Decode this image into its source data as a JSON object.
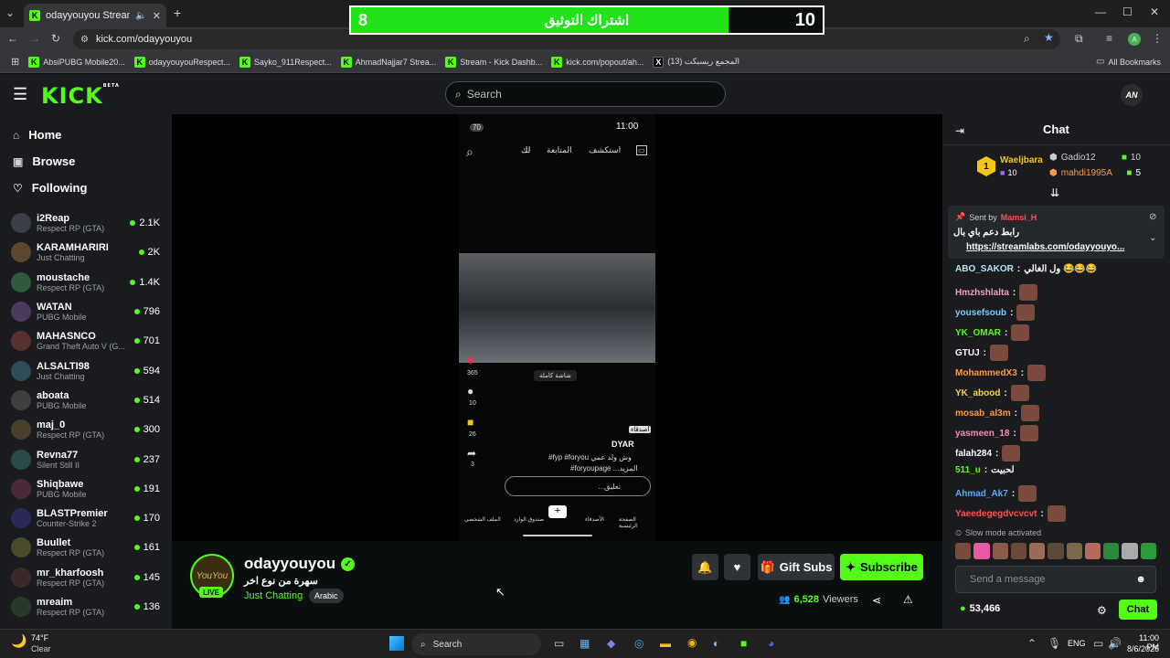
{
  "browser": {
    "tab_title": "odayyouyou Stream - Watc",
    "url": "kick.com/odayyouyou",
    "bookmarks": [
      {
        "label": "AbsiPUBG Mobile20..."
      },
      {
        "label": "odayyouyouRespect..."
      },
      {
        "label": "Sayko_911Respect..."
      },
      {
        "label": "AhmadNajjar7 Strea..."
      },
      {
        "label": "Stream - Kick Dashb..."
      },
      {
        "label": "kick.com/popout/ah..."
      },
      {
        "label": "(13) المجمع ريسبكت"
      }
    ],
    "all_bookmarks": "All Bookmarks"
  },
  "overlay": {
    "left_number": "8",
    "title": "اشتراك التوثيق",
    "right_number": "10",
    "progress_fraction": 0.8
  },
  "header": {
    "logo": "KICK",
    "beta": "BETA",
    "search_placeholder": "Search",
    "user_initials": "AN"
  },
  "sidebar": {
    "nav": [
      {
        "label": "Home",
        "icon": "home-icon"
      },
      {
        "label": "Browse",
        "icon": "browse-icon"
      },
      {
        "label": "Following",
        "icon": "heart-icon"
      }
    ],
    "channels": [
      {
        "name": "i2Reap",
        "category": "Respect RP (GTA)",
        "viewers": "2.1K"
      },
      {
        "name": "KARAMHARIRI",
        "category": "Just Chatting",
        "viewers": "2K"
      },
      {
        "name": "moustache",
        "category": "Respect RP (GTA)",
        "viewers": "1.4K"
      },
      {
        "name": "WATAN",
        "category": "PUBG Mobile",
        "viewers": "796"
      },
      {
        "name": "MAHASNCO",
        "category": "Grand Theft Auto V (G...",
        "viewers": "701"
      },
      {
        "name": "ALSALTI98",
        "category": "Just Chatting",
        "viewers": "594"
      },
      {
        "name": "aboata",
        "category": "PUBG Mobile",
        "viewers": "514"
      },
      {
        "name": "maj_0",
        "category": "Respect RP (GTA)",
        "viewers": "300"
      },
      {
        "name": "Revna77",
        "category": "Silent Still II",
        "viewers": "237"
      },
      {
        "name": "Shiqbawe",
        "category": "PUBG Mobile",
        "viewers": "191"
      },
      {
        "name": "BLASTPremier",
        "category": "Counter-Strike 2",
        "viewers": "170"
      },
      {
        "name": "Buullet",
        "category": "Respect RP (GTA)",
        "viewers": "161"
      },
      {
        "name": "mr_kharfoosh",
        "category": "Respect RP (GTA)",
        "viewers": "145"
      },
      {
        "name": "mreaim",
        "category": "Respect RP (GTA)",
        "viewers": "136"
      }
    ]
  },
  "phone": {
    "time": "11:00",
    "tabs": [
      "استكشف",
      "المتابعة",
      "لك"
    ],
    "likes": "365",
    "comments": "10",
    "saves": "26",
    "shares": "3",
    "username": "DYAR",
    "caption1": "#fyp #foryou وش ولد عمي",
    "caption2": "#foryoupage ...المزيد",
    "comment_placeholder": "...تعليق",
    "fullscreen_label": "شاشة كاملة",
    "friends_tag": "أصدقاء",
    "nav": [
      "الصفحة الرئيسية",
      "الأصدقاء",
      "",
      "صندوق الوارد",
      "الملف الشخصي"
    ]
  },
  "stream": {
    "channel": "odayyouyou",
    "title": "سهرة من نوع اخر",
    "category": "Just Chatting",
    "tag": "Arabic",
    "live": "LIVE",
    "viewers": "6,528",
    "viewers_label": "Viewers",
    "gift_subs": "Gift Subs",
    "subscribe": "Subscribe"
  },
  "chat": {
    "title": "Chat",
    "leaderboard": [
      {
        "name": "Waeljbara",
        "value": "10",
        "rank": "1"
      },
      {
        "name": "Gadio12",
        "value": "10"
      },
      {
        "name": "mahdi1995A",
        "value": "5"
      }
    ],
    "pinned": {
      "sent_by": "Sent by",
      "user": "Mamsi_H",
      "text": "رابط دعم باي بال",
      "link": "https://streamlabs.com/odayyouyo..."
    },
    "messages": [
      {
        "user": "ABO_SAKOR",
        "color": "#b8e3f5",
        "text": "ول الغالي 😂😂😂"
      },
      {
        "user": "Hmzhshlalta",
        "color": "#f0a0c0",
        "text": "",
        "emote": true
      },
      {
        "user": "yousefsoub",
        "color": "#7ec8ff",
        "text": "",
        "emote": true
      },
      {
        "user": "YK_OMAR",
        "color": "#53fc18",
        "text": "",
        "emote": true
      },
      {
        "user": "GTUJ",
        "color": "#ffffff",
        "text": "",
        "emote": true
      },
      {
        "user": "MohammedX3",
        "color": "#ff9a3c",
        "text": "",
        "emote": true
      },
      {
        "user": "YK_abood",
        "color": "#ffd23f",
        "text": "",
        "emote": true
      },
      {
        "user": "mosab_al3m",
        "color": "#ff9a3c",
        "text": "",
        "emote": true
      },
      {
        "user": "yasmeen_18",
        "color": "#f48fb1",
        "text": "",
        "emote": true
      },
      {
        "user": "falah284",
        "color": "#ffffff",
        "text": "",
        "emote": true
      },
      {
        "user": "511_u",
        "color": "#53fc18",
        "text": "لحبيت"
      },
      {
        "user": "Ahmad_Ak7",
        "color": "#5aa9ff",
        "text": "",
        "emote": true
      },
      {
        "user": "Yaeedegegdvcvcvt",
        "color": "#ff5050",
        "text": "",
        "emote": true
      }
    ],
    "slow_mode": "Slow mode activated",
    "input_placeholder": "Send a message",
    "points": "53,466",
    "chat_button": "Chat"
  },
  "taskbar": {
    "weather_temp": "74°F",
    "weather_desc": "Clear",
    "search": "Search",
    "lang": "ENG",
    "time": "11:00 PM",
    "date": "8/6/2025"
  }
}
